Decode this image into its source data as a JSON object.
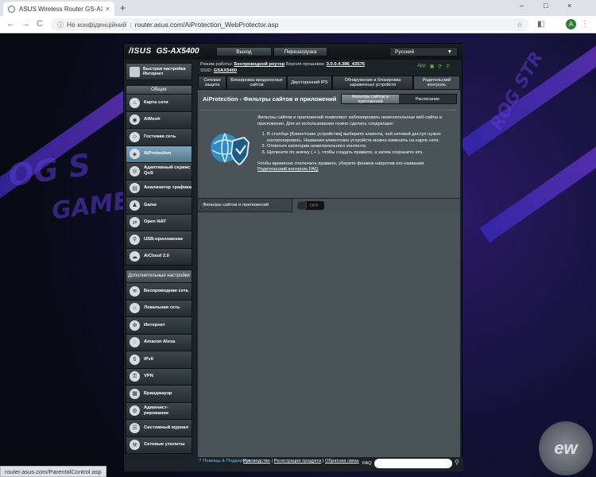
{
  "browser": {
    "tab_title": "ASUS Wireless Router GS-AX540…",
    "tab_close": "×",
    "new_tab": "+",
    "win_min": "–",
    "win_max": "□",
    "win_close": "×",
    "back": "←",
    "forward": "→",
    "reload": "C",
    "security_text": "Не конфіденційний",
    "url": "router.asus.com/AiProtection_WebProtector.asp",
    "avatar_letter": "A",
    "status_url": "router.asus.com/ParentalControl.asp"
  },
  "router": {
    "logo": "/ISUS",
    "model": "GS-AX5400",
    "logout": "Выход",
    "reboot": "Перезагрузка",
    "language": "Русский",
    "language_arrow": "▼",
    "mode_label": "Режим работы:",
    "mode_value": "Беспроводной роутер",
    "firmware_label": "Версия прошивки:",
    "firmware_value": "3.0.0.4.386_43576",
    "ssid_label": "SSID:",
    "ssid_value": "GSAX5400",
    "app_label": "App"
  },
  "sidebar": {
    "quick_setup": "Быстрая настройка Интернет",
    "general_header": "Общие",
    "general_items": [
      {
        "label": "Карта сети",
        "icon": "⌂"
      },
      {
        "label": "AiMesh",
        "icon": "◉"
      },
      {
        "label": "Гостевая сеть",
        "icon": "☺"
      },
      {
        "label": "AiProtection",
        "icon": "◈"
      },
      {
        "label": "Адаптивный сервис QoS",
        "icon": "◎"
      },
      {
        "label": "Анализатор трафика",
        "icon": "▤"
      },
      {
        "label": "Game",
        "icon": "♟"
      },
      {
        "label": "Open NAT",
        "icon": "⇄"
      },
      {
        "label": "USB-приложение",
        "icon": "⚲"
      },
      {
        "label": "AiCloud 2.0",
        "icon": "☁"
      }
    ],
    "advanced_header": "Дополнительные настройки",
    "advanced_items": [
      {
        "label": "Беспроводная сеть",
        "icon": "≋"
      },
      {
        "label": "Локальная сеть",
        "icon": "⌂"
      },
      {
        "label": "Интернет",
        "icon": "⊕"
      },
      {
        "label": "Amazon Alexa",
        "icon": "◌"
      },
      {
        "label": "IPv6",
        "icon": "6"
      },
      {
        "label": "VPN",
        "icon": "⚿"
      },
      {
        "label": "Брандмауэр",
        "icon": "▦"
      },
      {
        "label": "Админист-рирование",
        "icon": "⚙"
      },
      {
        "label": "Системный журнал",
        "icon": "☰"
      },
      {
        "label": "Сетевые утилиты",
        "icon": "⚒"
      }
    ]
  },
  "tabs": [
    "Сетевая защита",
    "Блокировка вредоносных сайтов",
    "Двусторонний IPS",
    "Обнаружение и блокировка зараженных устройств",
    "Родительский контроль"
  ],
  "main": {
    "title": "AiProtection - Фильтры сайтов и приложений",
    "seg_on": "Фильтры сайтов и приложений",
    "seg_off": "Расписание",
    "intro": "Фильтры сайтов и приложений позволяют заблокировать нежелательные веб-сайты и приложения. Для их использования нужно сделать следующее:",
    "steps": [
      "В столбце [Клиентские устройства] выберите клиента, чей сетевой доступ нужно контролировать. Названия клиентских устройств можно изменить на карте сети.",
      "Отметьте категории нежелательного контента.",
      "Щелкните по значку ( + ), чтобы создать правило, а затем сохраните его."
    ],
    "disable_note": "Чтобы временно отключить правило, уберите флажок напротив его названия.",
    "faq_link": "Родительский контроль FAQ",
    "field_label": "Фильтры сайтов и приложений",
    "toggle_text": "OFF"
  },
  "footer": {
    "help": "Помощь & Поддержка",
    "help_icon": "?",
    "manual": "Руководство",
    "register": "Регистрация продукта",
    "feedback": "Обратная связь",
    "faq": "FAQ"
  }
}
